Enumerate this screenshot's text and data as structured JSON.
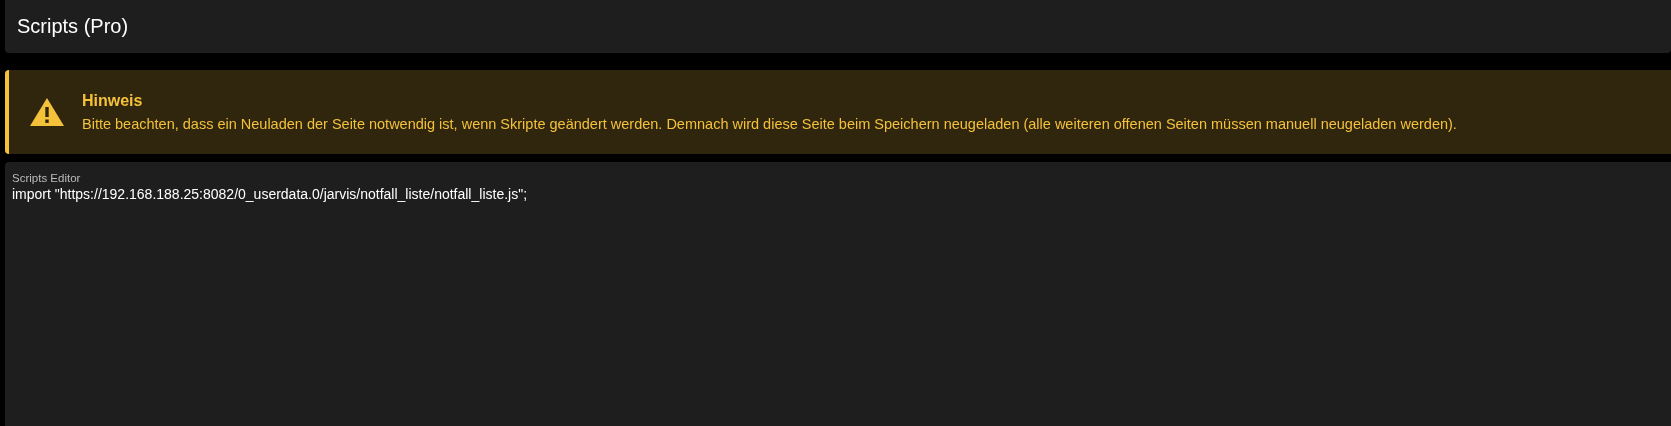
{
  "header": {
    "title": "Scripts (Pro)"
  },
  "alert": {
    "kind": "warning",
    "title": "Hinweis",
    "message": "Bitte beachten, dass ein Neuladen der Seite notwendig ist, wenn Skripte geändert werden. Demnach wird diese Seite beim Speichern neugeladen (alle weiteren offenen Seiten müssen manuell neugeladen werden)."
  },
  "editor": {
    "label": "Scripts Editor",
    "value": "import \"https://192.168.188.25:8082/0_userdata.0/jarvis/notfall_liste/notfall_liste.js\";"
  }
}
